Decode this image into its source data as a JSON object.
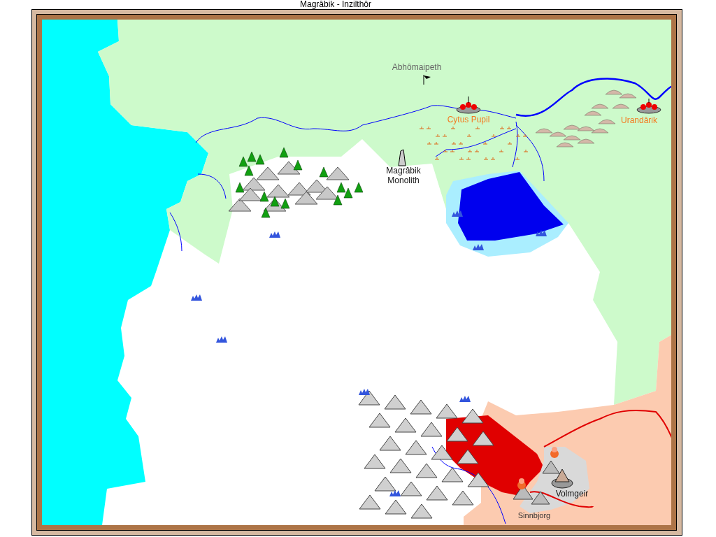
{
  "window": {
    "title": "Magrâbik - Inzilthôr"
  },
  "map": {
    "labels": [
      {
        "text": "Abhômaipeth",
        "kind": "region"
      },
      {
        "text": "Cytus Pupil",
        "kind": "town"
      },
      {
        "text": "Urandârik",
        "kind": "town"
      },
      {
        "text": "Magrâbik Monolith",
        "kind": "landmark"
      },
      {
        "text": "Volmgeir",
        "kind": "landmark"
      },
      {
        "text": "Sinnbjorg",
        "kind": "village"
      }
    ]
  }
}
